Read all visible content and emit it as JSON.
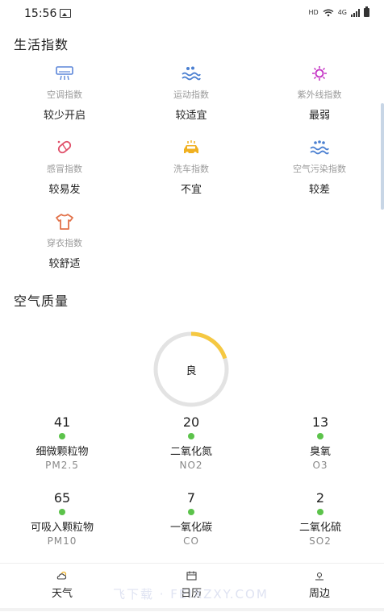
{
  "status_bar": {
    "time": "15:56",
    "network_hd": "HD",
    "network_4g": "4G"
  },
  "life_index": {
    "title": "生活指数",
    "items": [
      {
        "name": "空调指数",
        "value": "较少开启",
        "icon": "air-conditioner-icon",
        "color": "#5b86d9"
      },
      {
        "name": "运动指数",
        "value": "较适宜",
        "icon": "sport-icon",
        "color": "#4a7fd1"
      },
      {
        "name": "紫外线指数",
        "value": "最弱",
        "icon": "uv-sun-icon",
        "color": "#c431c4"
      },
      {
        "name": "感冒指数",
        "value": "较易发",
        "icon": "cold-pill-icon",
        "color": "#e0506a"
      },
      {
        "name": "洗车指数",
        "value": "不宜",
        "icon": "car-wash-icon",
        "color": "#f0b020"
      },
      {
        "name": "空气污染指数",
        "value": "较差",
        "icon": "air-pollution-icon",
        "color": "#4a7fd1"
      },
      {
        "name": "穿衣指数",
        "value": "较舒适",
        "icon": "clothing-icon",
        "color": "#e2724a"
      }
    ]
  },
  "air_quality": {
    "title": "空气质量",
    "level": "良",
    "gauge_fraction": 0.2,
    "gauge_color": "#f5c842",
    "track_color": "#e3e3e3",
    "dot_color": "#5cc34b",
    "items": [
      {
        "value": "41",
        "name": "细微颗粒物",
        "code": "PM2.5"
      },
      {
        "value": "20",
        "name": "二氧化氮",
        "code": "NO2"
      },
      {
        "value": "13",
        "name": "臭氧",
        "code": "O3"
      },
      {
        "value": "65",
        "name": "可吸入颗粒物",
        "code": "PM10"
      },
      {
        "value": "7",
        "name": "一氧化碳",
        "code": "CO"
      },
      {
        "value": "2",
        "name": "二氧化硫",
        "code": "SO2"
      }
    ]
  },
  "tabs": [
    {
      "label": "天气",
      "icon": "weather-icon"
    },
    {
      "label": "日历",
      "icon": "calendar-icon"
    },
    {
      "label": "周边",
      "icon": "location-icon"
    }
  ],
  "watermark": "飞下载 · FEIXZXY.COM"
}
